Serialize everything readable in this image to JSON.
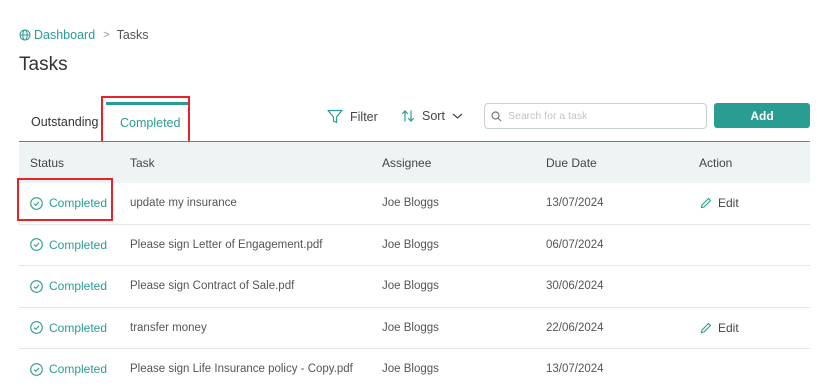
{
  "breadcrumb": {
    "home": "Dashboard",
    "separator": ">",
    "current": "Tasks"
  },
  "page_title": "Tasks",
  "tabs": [
    {
      "label": "Outstanding",
      "active": false
    },
    {
      "label": "Completed",
      "active": true
    }
  ],
  "toolbar": {
    "filter_label": "Filter",
    "sort_label": "Sort",
    "search_placeholder": "Search for a task",
    "add_label": "Add"
  },
  "table": {
    "columns": [
      "Status",
      "Task",
      "Assignee",
      "Due Date",
      "Action"
    ],
    "rows": [
      {
        "status": "Completed",
        "task": "update my insurance",
        "assignee": "Joe Bloggs",
        "due": "13/07/2024",
        "action": "Edit"
      },
      {
        "status": "Completed",
        "task": "Please sign Letter of Engagement.pdf",
        "assignee": "Joe Bloggs",
        "due": "06/07/2024",
        "action": ""
      },
      {
        "status": "Completed",
        "task": "Please sign Contract of Sale.pdf",
        "assignee": "Joe Bloggs",
        "due": "30/06/2024",
        "action": ""
      },
      {
        "status": "Completed",
        "task": "transfer money",
        "assignee": "Joe Bloggs",
        "due": "22/06/2024",
        "action": "Edit"
      },
      {
        "status": "Completed",
        "task": "Please sign Life Insurance policy - Copy.pdf",
        "assignee": "Joe Bloggs",
        "due": "13/07/2024",
        "action": ""
      }
    ]
  },
  "colors": {
    "accent": "#2a9d92",
    "highlight": "#e8212a",
    "header_bg": "#eef3f4"
  },
  "icons": [
    "globe-icon",
    "filter-icon",
    "sort-icon",
    "chevron-down-icon",
    "search-icon",
    "check-circle-icon",
    "pencil-icon"
  ]
}
